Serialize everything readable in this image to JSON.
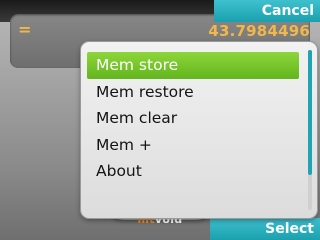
{
  "softkeys": {
    "cancel_label": "Cancel",
    "select_label": "Select"
  },
  "display": {
    "operator": "=",
    "value": "43.7984496"
  },
  "menu": {
    "items": [
      {
        "label": "Mem store",
        "selected": true
      },
      {
        "label": "Mem restore",
        "selected": false
      },
      {
        "label": "Mem clear",
        "selected": false
      },
      {
        "label": "Mem +",
        "selected": false
      },
      {
        "label": "About",
        "selected": false
      }
    ],
    "scroll_fraction_visible": 0.78
  },
  "brand": {
    "part1": "mt",
    "part2": "void"
  },
  "colors": {
    "accent_teal": "#1aa0ae",
    "highlight_green": "#7cc832",
    "display_amber": "#f0b84a",
    "brand_orange": "#f08a1a"
  }
}
